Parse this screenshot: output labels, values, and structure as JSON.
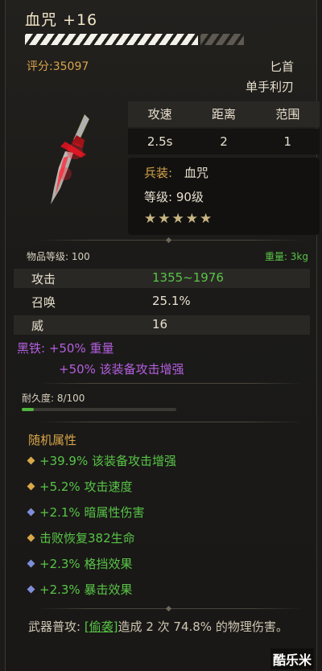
{
  "item": {
    "name": "血咒 +16",
    "score": "评分:35097",
    "weapon_type": "匕首",
    "hand_type": "单手利刃",
    "stats_table": {
      "headers": [
        "攻速",
        "距离",
        "范围"
      ],
      "values": [
        "2.5s",
        "2",
        "1"
      ]
    },
    "info": {
      "weapon_label": "兵装:",
      "weapon_name": "血咒",
      "level": "等级: 90级",
      "stars_text": "★★★★★",
      "stars": 5
    },
    "item_level": "物品等级: 100",
    "weight": "重量: 3kg",
    "attributes": [
      {
        "label": "攻击",
        "value": "1355~1976"
      },
      {
        "label": "召唤",
        "value": "25.1%"
      },
      {
        "label": "威",
        "value": "16"
      }
    ],
    "black_iron": {
      "label": "黑铁: +50% 重量",
      "line2": "+50% 该装备攻击增强"
    },
    "durability": {
      "label": "耐久度: 8/100",
      "fraction": 0.08
    },
    "random_title": "随机属性",
    "random_attrs": [
      {
        "text": "+39.9% 该装备攻击增强",
        "gem": "gold"
      },
      {
        "text": "+5.2% 攻击速度",
        "gem": "gold"
      },
      {
        "text": "+2.1% 暗属性伤害",
        "gem": "blue"
      },
      {
        "text": "击败恢复382生命",
        "gem": "gold"
      },
      {
        "text": "+2.3% 格挡效果",
        "gem": "blue"
      },
      {
        "text": "+2.3% 暴击效果",
        "gem": "blue"
      }
    ],
    "normal_attack": {
      "prefix": "武器普攻: ",
      "link": "[偷袭]",
      "suffix": "造成 2 次 74.8% 的物理伤害。"
    }
  },
  "watermark": "酷乐米",
  "colors": {
    "gold": "#d8a54a",
    "green": "#58c447",
    "purple": "#b45fe0",
    "gem_blue": "#7f8ed8"
  }
}
